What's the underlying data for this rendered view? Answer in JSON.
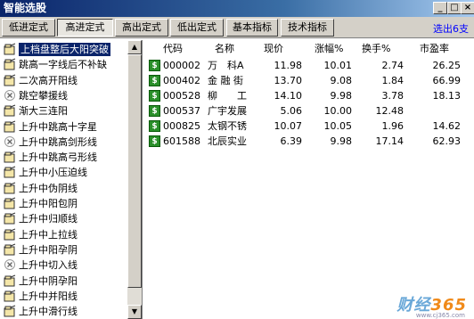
{
  "window": {
    "title": "智能选股"
  },
  "toolbar": {
    "tabs": [
      "低进定式",
      "高进定式",
      "高出定式",
      "低出定式",
      "基本指标",
      "技术指标"
    ],
    "active_tab": "高进定式",
    "result_count": "选出6支"
  },
  "left_list": {
    "items": [
      {
        "label": "上档盘整后大阳突破",
        "icon": "stock-folder-icon",
        "selected": true
      },
      {
        "label": "跳高一字线后不补缺",
        "icon": "stock-folder-icon"
      },
      {
        "label": "二次高开阳线",
        "icon": "stock-folder-icon"
      },
      {
        "label": "跳空攀援线",
        "icon": "disabled-x-icon"
      },
      {
        "label": "渐大三连阳",
        "icon": "stock-folder-icon"
      },
      {
        "label": "上升中跳高十字星",
        "icon": "stock-folder-icon"
      },
      {
        "label": "上升中跳高剑形线",
        "icon": "disabled-x-icon"
      },
      {
        "label": "上升中跳高弓形线",
        "icon": "stock-folder-icon"
      },
      {
        "label": "上升中小压迫线",
        "icon": "stock-folder-icon"
      },
      {
        "label": "上升中伪阴线",
        "icon": "stock-folder-icon"
      },
      {
        "label": "上升中阳包阴",
        "icon": "stock-folder-icon"
      },
      {
        "label": "上升中归顺线",
        "icon": "stock-folder-icon"
      },
      {
        "label": "上升中上拉线",
        "icon": "stock-folder-icon"
      },
      {
        "label": "上升中阳孕阴",
        "icon": "stock-folder-icon"
      },
      {
        "label": "上升中切入线",
        "icon": "disabled-x-icon"
      },
      {
        "label": "上升中阴孕阳",
        "icon": "stock-folder-icon"
      },
      {
        "label": "上升中并阳线",
        "icon": "stock-folder-icon"
      },
      {
        "label": "上升中滑行线",
        "icon": "stock-folder-icon"
      }
    ]
  },
  "table": {
    "columns": [
      "代码",
      "名称",
      "现价",
      "涨幅%",
      "换手%",
      "市盈率"
    ],
    "rows": [
      {
        "code": "000002",
        "name": "万　科A",
        "price": "11.98",
        "change": "10.01",
        "turnover": "2.74",
        "pe": "26.25"
      },
      {
        "code": "000402",
        "name": "金 融 街",
        "price": "13.70",
        "change": "9.08",
        "turnover": "1.84",
        "pe": "66.99"
      },
      {
        "code": "000528",
        "name": "柳　　工",
        "price": "14.10",
        "change": "9.98",
        "turnover": "3.78",
        "pe": "18.13"
      },
      {
        "code": "000537",
        "name": "广宇发展",
        "price": "5.06",
        "change": "10.00",
        "turnover": "12.48",
        "pe": ""
      },
      {
        "code": "000825",
        "name": "太钢不锈",
        "price": "10.07",
        "change": "10.05",
        "turnover": "1.96",
        "pe": "14.62"
      },
      {
        "code": "601588",
        "name": "北辰实业",
        "price": "6.39",
        "change": "9.98",
        "turnover": "17.14",
        "pe": "62.93"
      }
    ]
  },
  "watermark": {
    "brand": "财经",
    "number": "365",
    "url": "www.cj365.com"
  },
  "colors": {
    "selection": "#0a246a",
    "count_text": "#0000ff",
    "dollar_icon": "#2a8f2a"
  }
}
